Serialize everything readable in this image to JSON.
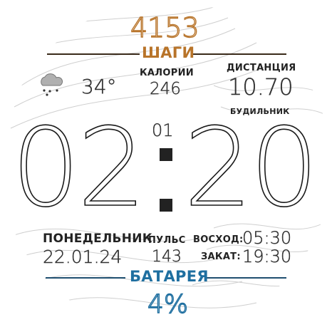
{
  "steps": {
    "value": "4153",
    "label": "ШАГИ"
  },
  "weather": {
    "icon": "cloud-rain-snow-icon",
    "temperature": "34°"
  },
  "calories": {
    "label": "КАЛОРИИ",
    "value": "246"
  },
  "distance": {
    "label": "ДИСТАНЦИЯ",
    "value": "10.70"
  },
  "alarm": {
    "label": "БУДИЛЬНИК"
  },
  "time": {
    "hours": "02",
    "minutes": "20",
    "seconds": "01"
  },
  "date": {
    "weekday": "ПОНЕДЕЛЬНИК",
    "value": "22.01.24"
  },
  "pulse": {
    "label": "ПУЛЬС",
    "value": "143"
  },
  "sunrise": {
    "label": "ВОСХОД:",
    "value": "05:30"
  },
  "sunset": {
    "label": "ЗАКАТ:",
    "value": "19:30"
  },
  "battery": {
    "label": "БАТАРЕЯ",
    "value": "4%"
  },
  "colors": {
    "orange": "#b8742a",
    "blue": "#1f6fa0",
    "dark": "#222222"
  }
}
